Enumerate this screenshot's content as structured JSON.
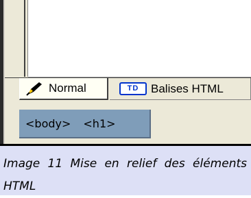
{
  "tabs": {
    "normal": {
      "label": "Normal",
      "icon": "pen-icon"
    },
    "balises": {
      "label": "Balises HTML",
      "icon_text": "TD",
      "icon": "td-tag-icon"
    }
  },
  "tag_bar": {
    "items": [
      "<body>",
      "<h1>"
    ]
  },
  "caption": {
    "text": "Image 11 Mise en relief des éléments HTML"
  },
  "colors": {
    "window_bg": "#ece9d8",
    "tag_bar_bg": "#7f9db9",
    "caption_bg": "#dde0f6",
    "td_icon_blue": "#0033cc"
  }
}
